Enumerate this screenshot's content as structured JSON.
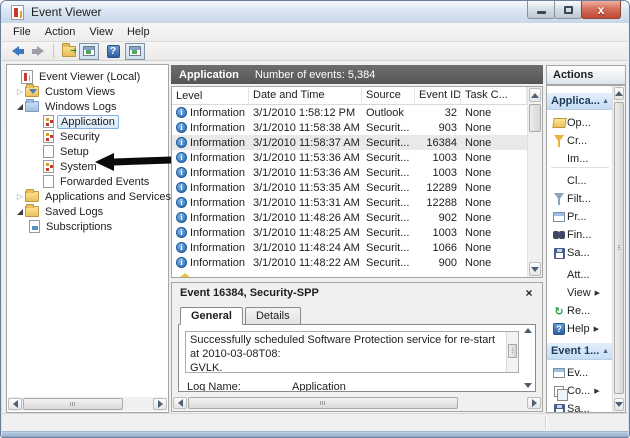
{
  "window": {
    "title": "Event Viewer"
  },
  "menu": {
    "items": [
      "File",
      "Action",
      "View",
      "Help"
    ]
  },
  "toolbar": {
    "icons": [
      "back-arrow",
      "forward-arrow",
      "export-log",
      "console-tree-toggle",
      "help",
      "action-pane-toggle"
    ]
  },
  "tree": {
    "items": [
      {
        "label": "Event Viewer (Local)"
      },
      {
        "label": "Custom Views"
      },
      {
        "label": "Windows Logs"
      },
      {
        "label": "Application"
      },
      {
        "label": "Security"
      },
      {
        "label": "Setup"
      },
      {
        "label": "System"
      },
      {
        "label": "Forwarded Events"
      },
      {
        "label": "Applications and Services Lo"
      },
      {
        "label": "Saved Logs"
      },
      {
        "label": "Subscriptions"
      }
    ],
    "selected": "Application"
  },
  "list": {
    "header_title": "Application",
    "header_info": "Number of events: 5,384",
    "columns": [
      "Level",
      "Date and Time",
      "Source",
      "Event ID",
      "Task C..."
    ],
    "selected_row_index": 2,
    "rows": [
      {
        "level": "Information",
        "datetime": "3/1/2010 1:58:12 PM",
        "source": "Outlook",
        "event_id": "32",
        "task": "None"
      },
      {
        "level": "Information",
        "datetime": "3/1/2010 11:58:38 AM",
        "source": "Securit...",
        "event_id": "903",
        "task": "None"
      },
      {
        "level": "Information",
        "datetime": "3/1/2010 11:58:37 AM",
        "source": "Securit...",
        "event_id": "16384",
        "task": "None"
      },
      {
        "level": "Information",
        "datetime": "3/1/2010 11:53:36 AM",
        "source": "Securit...",
        "event_id": "1003",
        "task": "None"
      },
      {
        "level": "Information",
        "datetime": "3/1/2010 11:53:36 AM",
        "source": "Securit...",
        "event_id": "1003",
        "task": "None"
      },
      {
        "level": "Information",
        "datetime": "3/1/2010 11:53:35 AM",
        "source": "Securit...",
        "event_id": "12289",
        "task": "None"
      },
      {
        "level": "Information",
        "datetime": "3/1/2010 11:53:31 AM",
        "source": "Securit...",
        "event_id": "12288",
        "task": "None"
      },
      {
        "level": "Information",
        "datetime": "3/1/2010 11:48:26 AM",
        "source": "Securit...",
        "event_id": "902",
        "task": "None"
      },
      {
        "level": "Information",
        "datetime": "3/1/2010 11:48:25 AM",
        "source": "Securit...",
        "event_id": "1003",
        "task": "None"
      },
      {
        "level": "Information",
        "datetime": "3/1/2010 11:48:24 AM",
        "source": "Securit...",
        "event_id": "1066",
        "task": "None"
      },
      {
        "level": "Information",
        "datetime": "3/1/2010 11:48:22 AM",
        "source": "Securit...",
        "event_id": "900",
        "task": "None"
      }
    ]
  },
  "preview": {
    "title": "Event 16384, Security-SPP",
    "tabs": [
      "General",
      "Details"
    ],
    "active_tab": "General",
    "message_line1": "Successfully scheduled Software Protection service for re-start at 2010-03-08T08:",
    "message_line2": "GVLK.",
    "fields": [
      {
        "label": "Log Name:",
        "value": "Application"
      }
    ]
  },
  "actions": {
    "title": "Actions",
    "sections": [
      {
        "header": "Applica...",
        "items": [
          {
            "label": "Op..."
          },
          {
            "label": "Cr..."
          },
          {
            "label": "Im..."
          },
          {
            "label": "Cl..."
          },
          {
            "label": "Filt..."
          },
          {
            "label": "Pr..."
          },
          {
            "label": "Fin..."
          },
          {
            "label": "Sa..."
          },
          {
            "label": "Att..."
          },
          {
            "label": "View"
          },
          {
            "label": "Re..."
          },
          {
            "label": "Help"
          }
        ]
      },
      {
        "header": "Event 1...",
        "items": [
          {
            "label": "Ev..."
          },
          {
            "label": "Co..."
          },
          {
            "label": "Sa..."
          }
        ]
      }
    ]
  }
}
